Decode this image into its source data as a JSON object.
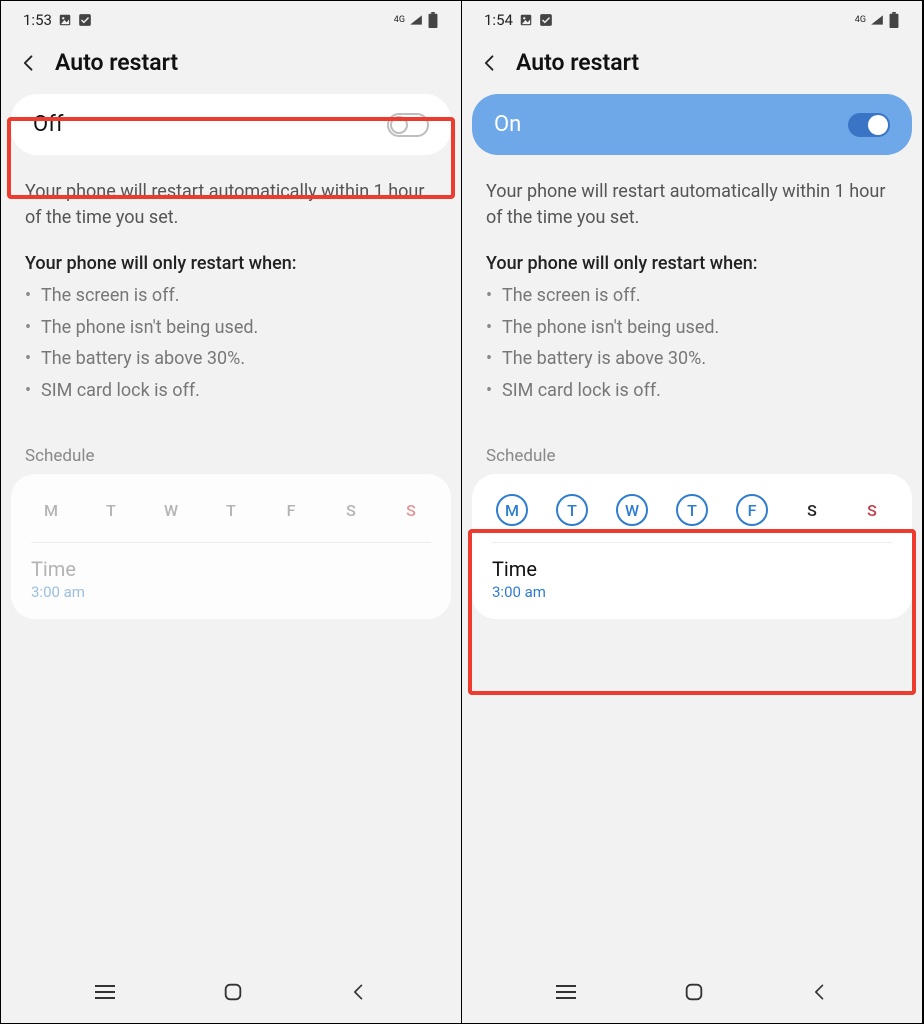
{
  "left": {
    "status": {
      "time": "1:53",
      "network": "4G"
    },
    "header": {
      "title": "Auto restart"
    },
    "toggle": {
      "state_label": "Off"
    },
    "description": "Your phone will restart automatically within 1 hour of the time you set.",
    "conditions_title": "Your phone will only restart when:",
    "conditions": [
      "The screen is off.",
      "The phone isn't being used.",
      "The battery is above 30%.",
      "SIM card lock is off."
    ],
    "schedule_label": "Schedule",
    "days": [
      "M",
      "T",
      "W",
      "T",
      "F",
      "S",
      "S"
    ],
    "time_label": "Time",
    "time_value": "3:00 am"
  },
  "right": {
    "status": {
      "time": "1:54",
      "network": "4G"
    },
    "header": {
      "title": "Auto restart"
    },
    "toggle": {
      "state_label": "On"
    },
    "description": "Your phone will restart automatically within 1 hour of the time you set.",
    "conditions_title": "Your phone will only restart when:",
    "conditions": [
      "The screen is off.",
      "The phone isn't being used.",
      "The battery is above 30%.",
      "SIM card lock is off."
    ],
    "schedule_label": "Schedule",
    "days": [
      "M",
      "T",
      "W",
      "T",
      "F",
      "S",
      "S"
    ],
    "days_selected": [
      true,
      true,
      true,
      true,
      true,
      false,
      false
    ],
    "time_label": "Time",
    "time_value": "3:00 am"
  }
}
